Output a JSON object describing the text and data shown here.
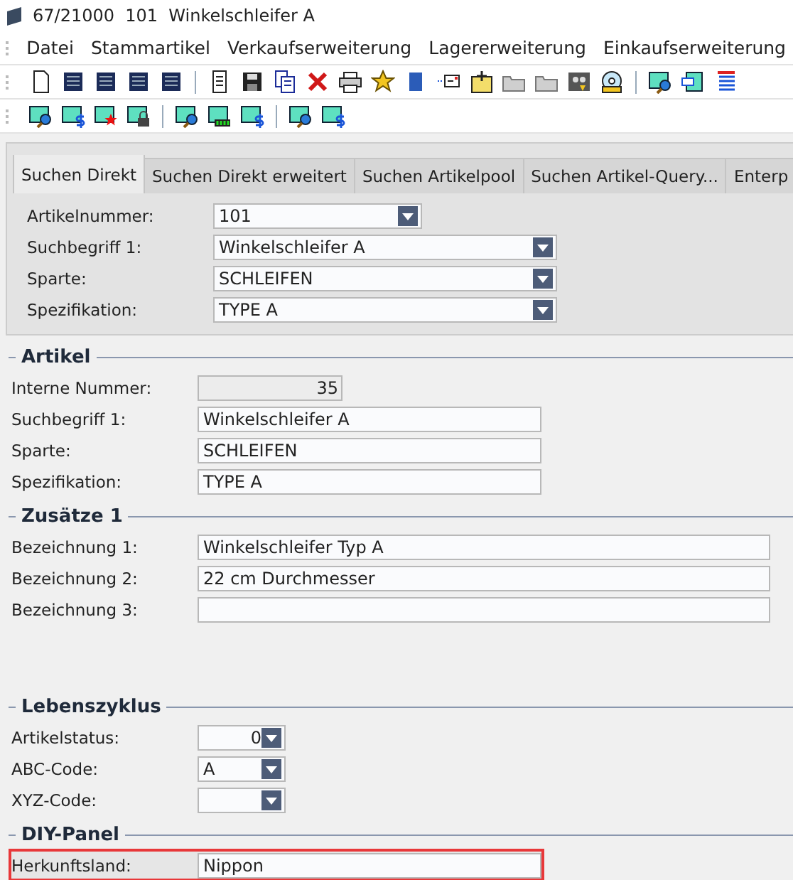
{
  "window": {
    "title": "67/21000  101  Winkelschleifer A"
  },
  "menu": [
    "Datei",
    "Stammartikel",
    "Verkaufserweiterung",
    "Lagererweiterung",
    "Einkaufserweiterung"
  ],
  "search_panel": {
    "tabs": [
      {
        "label": "Suchen Direkt",
        "selected": true
      },
      {
        "label": "Suchen Direkt erweitert",
        "selected": false
      },
      {
        "label": "Suchen Artikelpool",
        "selected": false
      },
      {
        "label": "Suchen Artikel-Query...",
        "selected": false
      },
      {
        "label": "Enterp",
        "selected": false
      }
    ],
    "fields": [
      {
        "label": "Artikelnummer:",
        "value": "101",
        "kind": "short_combo"
      },
      {
        "label": "Suchbegriff 1:",
        "value": "Winkelschleifer A",
        "kind": "combo"
      },
      {
        "label": "Sparte:",
        "value": "SCHLEIFEN",
        "kind": "combo"
      },
      {
        "label": "Spezifikation:",
        "value": "TYPE A",
        "kind": "combo"
      }
    ]
  },
  "sections": [
    {
      "title": "Artikel",
      "fields": [
        {
          "label": "Interne Nummer:",
          "value": "35",
          "kind": "readonly_number"
        },
        {
          "label": "Suchbegriff 1:",
          "value": "Winkelschleifer A",
          "kind": "text"
        },
        {
          "label": "Sparte:",
          "value": "SCHLEIFEN",
          "kind": "text"
        },
        {
          "label": "Spezifikation:",
          "value": "TYPE A",
          "kind": "text"
        }
      ]
    },
    {
      "title": "Zusätze 1",
      "fields": [
        {
          "label": "Bezeichnung 1:",
          "value": "Winkelschleifer Typ A",
          "kind": "wide_text"
        },
        {
          "label": "Bezeichnung 2:",
          "value": "22 cm Durchmesser",
          "kind": "wide_text"
        },
        {
          "label": "Bezeichnung 3:",
          "kind": "wide_text"
        }
      ]
    },
    {
      "title": "Lebenszyklus",
      "fields": [
        {
          "label": "Artikelstatus:",
          "value": "0",
          "kind": "small_combo_number"
        },
        {
          "label": "ABC-Code:",
          "value": "A",
          "kind": "small_combo"
        },
        {
          "label": "XYZ-Code:",
          "kind": "small_combo"
        }
      ]
    },
    {
      "title": "DIY-Panel",
      "fields": [
        {
          "label": "Herkunftsland:",
          "value": "Nippon",
          "kind": "text",
          "highlighted": true
        }
      ]
    }
  ]
}
